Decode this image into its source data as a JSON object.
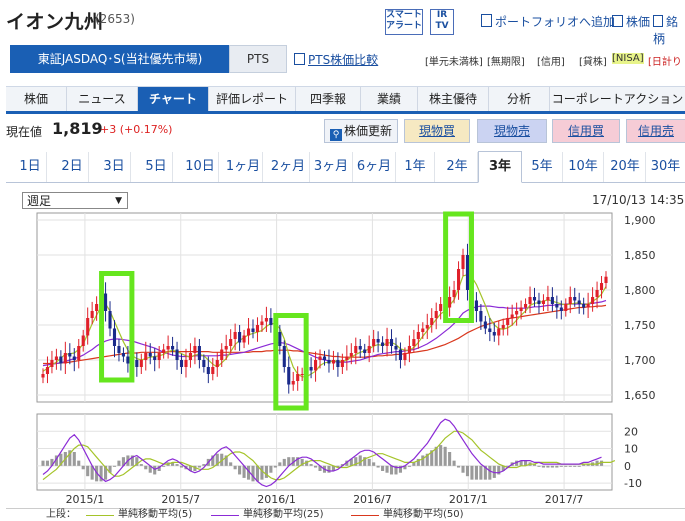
{
  "header": {
    "title": "イオン九州",
    "code": "(2653)",
    "smart_alert": "スマート\nアラート",
    "ir_tv": "IR\nTV",
    "portfolio_link": "ポートフォリオへ追加",
    "stock_price_link": "株価",
    "search_link": "銘柄"
  },
  "market": {
    "active_tab": "東証JASDAQ･S(当社優先市場)",
    "pts_tab": "PTS",
    "pts_compare": "PTS株価比較",
    "tags": [
      "[単元未満株]",
      "[無期限]",
      "[信用]",
      "[貸株]",
      "[NISA]",
      "[日計り"
    ]
  },
  "nav": [
    "株価",
    "ニュース",
    "チャート",
    "評価レポート",
    "四季報",
    "業績",
    "株主優待",
    "分析",
    "コーポレートアクション"
  ],
  "nav_active_index": 2,
  "price": {
    "label": "現在値",
    "value": "1,819",
    "change": "+3 (+0.17%)"
  },
  "buttons": {
    "refresh": "株価更新",
    "spot_buy": "現物買",
    "spot_sell": "現物売",
    "margin_buy": "信用買",
    "margin_sell": "信用売"
  },
  "ranges": [
    "1日",
    "2日",
    "3日",
    "5日",
    "10日",
    "1ヶ月",
    "2ヶ月",
    "3ヶ月",
    "6ヶ月",
    "1年",
    "2年",
    "3年",
    "5年",
    "10年",
    "20年",
    "30年"
  ],
  "range_active_index": 11,
  "chart_controls": {
    "period_select": "週足",
    "timestamp": "17/10/13 14:35"
  },
  "legend": {
    "prefix": "上段：",
    "ma5": "単純移動平均(5)",
    "ma25": "単純移動平均(25)",
    "ma50": "単純移動平均(50)"
  },
  "colors": {
    "accent": "#1a5fb4",
    "up_candle": "#e0202a",
    "down_candle": "#1a2a8a",
    "ma5": "#a5c42a",
    "ma25": "#8b2bd6",
    "ma50": "#d9381e",
    "highlight": "#66e61e"
  },
  "chart_data": {
    "type": "candlestick",
    "y_ticks": [
      "1,900",
      "1,850",
      "1,800",
      "1,750",
      "1,700",
      "1,650"
    ],
    "ylim": [
      1640,
      1910
    ],
    "x_ticks": [
      "2015/1",
      "2015/7",
      "2016/1",
      "2016/7",
      "2017/1",
      "2017/7"
    ],
    "x_tick_dates": [
      "2015-01",
      "2015-07",
      "2016-01",
      "2016-07",
      "2017-01",
      "2017-07"
    ],
    "x_range": [
      "2014-10",
      "2017-10"
    ],
    "closes": [
      1680,
      1690,
      1700,
      1705,
      1695,
      1710,
      1705,
      1700,
      1720,
      1735,
      1760,
      1770,
      1780,
      1795,
      1770,
      1745,
      1720,
      1710,
      1705,
      1695,
      1700,
      1690,
      1700,
      1710,
      1705,
      1700,
      1710,
      1715,
      1720,
      1715,
      1700,
      1690,
      1700,
      1710,
      1720,
      1700,
      1690,
      1680,
      1690,
      1700,
      1715,
      1720,
      1730,
      1740,
      1725,
      1735,
      1745,
      1740,
      1750,
      1755,
      1760,
      1750,
      1740,
      1720,
      1690,
      1665,
      1670,
      1680,
      1680,
      1690,
      1685,
      1700,
      1705,
      1700,
      1695,
      1700,
      1690,
      1700,
      1705,
      1710,
      1720,
      1715,
      1710,
      1720,
      1730,
      1725,
      1720,
      1730,
      1720,
      1715,
      1700,
      1710,
      1720,
      1730,
      1740,
      1745,
      1750,
      1760,
      1770,
      1780,
      1775,
      1790,
      1800,
      1830,
      1850,
      1800,
      1785,
      1770,
      1755,
      1745,
      1740,
      1735,
      1745,
      1750,
      1760,
      1765,
      1770,
      1775,
      1780,
      1790,
      1785,
      1780,
      1785,
      1790,
      1780,
      1775,
      1770,
      1780,
      1790,
      1785,
      1780,
      1775,
      1780,
      1790,
      1800,
      1810,
      1819
    ],
    "ma5": [
      1684,
      1688,
      1693,
      1697,
      1703,
      1708,
      1709,
      1710,
      1715,
      1723,
      1737,
      1752,
      1764,
      1776,
      1780,
      1770,
      1755,
      1740,
      1726,
      1714,
      1706,
      1702,
      1700,
      1702,
      1704,
      1705,
      1706,
      1708,
      1712,
      1714,
      1712,
      1709,
      1706,
      1704,
      1707,
      1708,
      1706,
      1700,
      1694,
      1690,
      1696,
      1702,
      1712,
      1722,
      1728,
      1732,
      1736,
      1738,
      1740,
      1742,
      1748,
      1752,
      1752,
      1745,
      1730,
      1708,
      1690,
      1680,
      1676,
      1676,
      1680,
      1684,
      1692,
      1696,
      1697,
      1699,
      1698,
      1698,
      1700,
      1704,
      1708,
      1711,
      1713,
      1716,
      1720,
      1722,
      1721,
      1724,
      1725,
      1722,
      1716,
      1714,
      1714,
      1718,
      1725,
      1734,
      1742,
      1750,
      1758,
      1766,
      1770,
      1778,
      1786,
      1802,
      1820,
      1822,
      1818,
      1808,
      1793,
      1778,
      1760,
      1750,
      1745,
      1744,
      1746,
      1750,
      1757,
      1764,
      1770,
      1778,
      1781,
      1782,
      1784,
      1786,
      1784,
      1782,
      1780,
      1779,
      1780,
      1781,
      1782,
      1779,
      1780,
      1784,
      1788,
      1794,
      1805
    ],
    "ma25": [
      1692,
      1693,
      1694,
      1695,
      1696,
      1698,
      1700,
      1702,
      1704,
      1707,
      1711,
      1715,
      1720,
      1724,
      1727,
      1729,
      1730,
      1730,
      1729,
      1728,
      1727,
      1725,
      1723,
      1721,
      1719,
      1717,
      1714,
      1711,
      1709,
      1707,
      1706,
      1705,
      1705,
      1705,
      1706,
      1706,
      1706,
      1706,
      1706,
      1706,
      1707,
      1707,
      1708,
      1709,
      1710,
      1711,
      1713,
      1715,
      1717,
      1719,
      1721,
      1723,
      1724,
      1725,
      1724,
      1722,
      1719,
      1716,
      1713,
      1710,
      1707,
      1704,
      1702,
      1700,
      1699,
      1698,
      1697,
      1697,
      1697,
      1698,
      1699,
      1700,
      1702,
      1704,
      1706,
      1708,
      1709,
      1710,
      1711,
      1712,
      1712,
      1713,
      1714,
      1715,
      1717,
      1720,
      1723,
      1727,
      1731,
      1736,
      1741,
      1746,
      1752,
      1759,
      1767,
      1771,
      1774,
      1776,
      1777,
      1777,
      1777,
      1776,
      1775,
      1775,
      1774,
      1774,
      1774,
      1774,
      1774,
      1775,
      1776,
      1776,
      1777,
      1778,
      1778,
      1779,
      1779,
      1780,
      1780,
      1780,
      1780,
      1780,
      1780,
      1781,
      1782,
      1783,
      1785
    ],
    "ma50": [
      1695,
      1695,
      1695,
      1695,
      1696,
      1696,
      1697,
      1698,
      1699,
      1700,
      1701,
      1702,
      1703,
      1704,
      1705,
      1706,
      1707,
      1708,
      1709,
      1710,
      1710,
      1710,
      1711,
      1711,
      1711,
      1711,
      1711,
      1711,
      1712,
      1712,
      1712,
      1712,
      1712,
      1712,
      1712,
      1712,
      1712,
      1712,
      1711,
      1711,
      1711,
      1711,
      1711,
      1711,
      1711,
      1711,
      1711,
      1712,
      1712,
      1712,
      1713,
      1713,
      1714,
      1714,
      1714,
      1714,
      1713,
      1713,
      1712,
      1711,
      1710,
      1709,
      1708,
      1707,
      1706,
      1705,
      1705,
      1704,
      1704,
      1704,
      1704,
      1704,
      1704,
      1705,
      1705,
      1706,
      1706,
      1707,
      1707,
      1708,
      1708,
      1709,
      1710,
      1711,
      1712,
      1713,
      1714,
      1716,
      1718,
      1720,
      1722,
      1725,
      1728,
      1731,
      1735,
      1739,
      1742,
      1745,
      1748,
      1750,
      1752,
      1754,
      1756,
      1758,
      1759,
      1760,
      1761,
      1762,
      1763,
      1764,
      1765,
      1766,
      1767,
      1768,
      1769,
      1770,
      1771,
      1772,
      1773,
      1774,
      1775,
      1775,
      1776,
      1776,
      1777,
      1777,
      1778
    ],
    "osc_y_ticks": [
      "20",
      "10",
      "0",
      "-10"
    ],
    "osc_ylim": [
      -14,
      30
    ],
    "osc_fast": [
      -5,
      -3,
      0,
      4,
      8,
      12,
      16,
      18,
      15,
      10,
      5,
      0,
      -4,
      -7,
      -9,
      -8,
      -6,
      -3,
      0,
      3,
      5,
      6,
      4,
      2,
      0,
      -2,
      -1,
      1,
      3,
      4,
      3,
      1,
      -1,
      -3,
      -4,
      -3,
      -1,
      2,
      5,
      8,
      10,
      11,
      9,
      6,
      3,
      0,
      -3,
      -6,
      -9,
      -11,
      -12,
      -11,
      -9,
      -6,
      -3,
      0,
      2,
      4,
      5,
      5,
      4,
      2,
      0,
      -2,
      -3,
      -3,
      -2,
      0,
      2,
      4,
      6,
      8,
      9,
      9,
      8,
      6,
      4,
      2,
      0,
      -1,
      -1,
      0,
      2,
      4,
      7,
      10,
      13,
      17,
      21,
      25,
      27,
      26,
      23,
      19,
      15,
      11,
      7,
      4,
      1,
      -1,
      -3,
      -4,
      -4,
      -3,
      -1,
      1,
      2,
      3,
      3,
      3,
      2,
      2,
      1,
      1,
      1,
      1,
      1,
      1,
      1,
      1,
      1,
      2,
      2,
      3,
      4,
      5
    ],
    "osc_slow": [
      -8,
      -6,
      -4,
      -2,
      1,
      4,
      7,
      10,
      12,
      12,
      11,
      8,
      5,
      2,
      -1,
      -4,
      -6,
      -6,
      -5,
      -3,
      -1,
      1,
      3,
      4,
      4,
      3,
      2,
      1,
      1,
      2,
      2,
      2,
      1,
      0,
      -1,
      -2,
      -2,
      -2,
      -1,
      1,
      3,
      5,
      7,
      8,
      8,
      7,
      5,
      3,
      0,
      -3,
      -5,
      -7,
      -8,
      -8,
      -7,
      -5,
      -3,
      -1,
      1,
      2,
      3,
      3,
      3,
      2,
      1,
      0,
      -1,
      -1,
      -1,
      0,
      1,
      2,
      4,
      5,
      6,
      7,
      7,
      6,
      5,
      4,
      3,
      2,
      2,
      2,
      3,
      4,
      6,
      8,
      10,
      13,
      16,
      18,
      20,
      20,
      19,
      17,
      15,
      12,
      9,
      7,
      5,
      3,
      1,
      0,
      -1,
      -1,
      -1,
      0,
      0,
      1,
      1,
      2,
      2,
      2,
      2,
      2,
      1,
      1,
      1,
      1,
      1,
      1,
      1,
      1,
      1,
      2,
      2,
      2,
      3
    ]
  }
}
